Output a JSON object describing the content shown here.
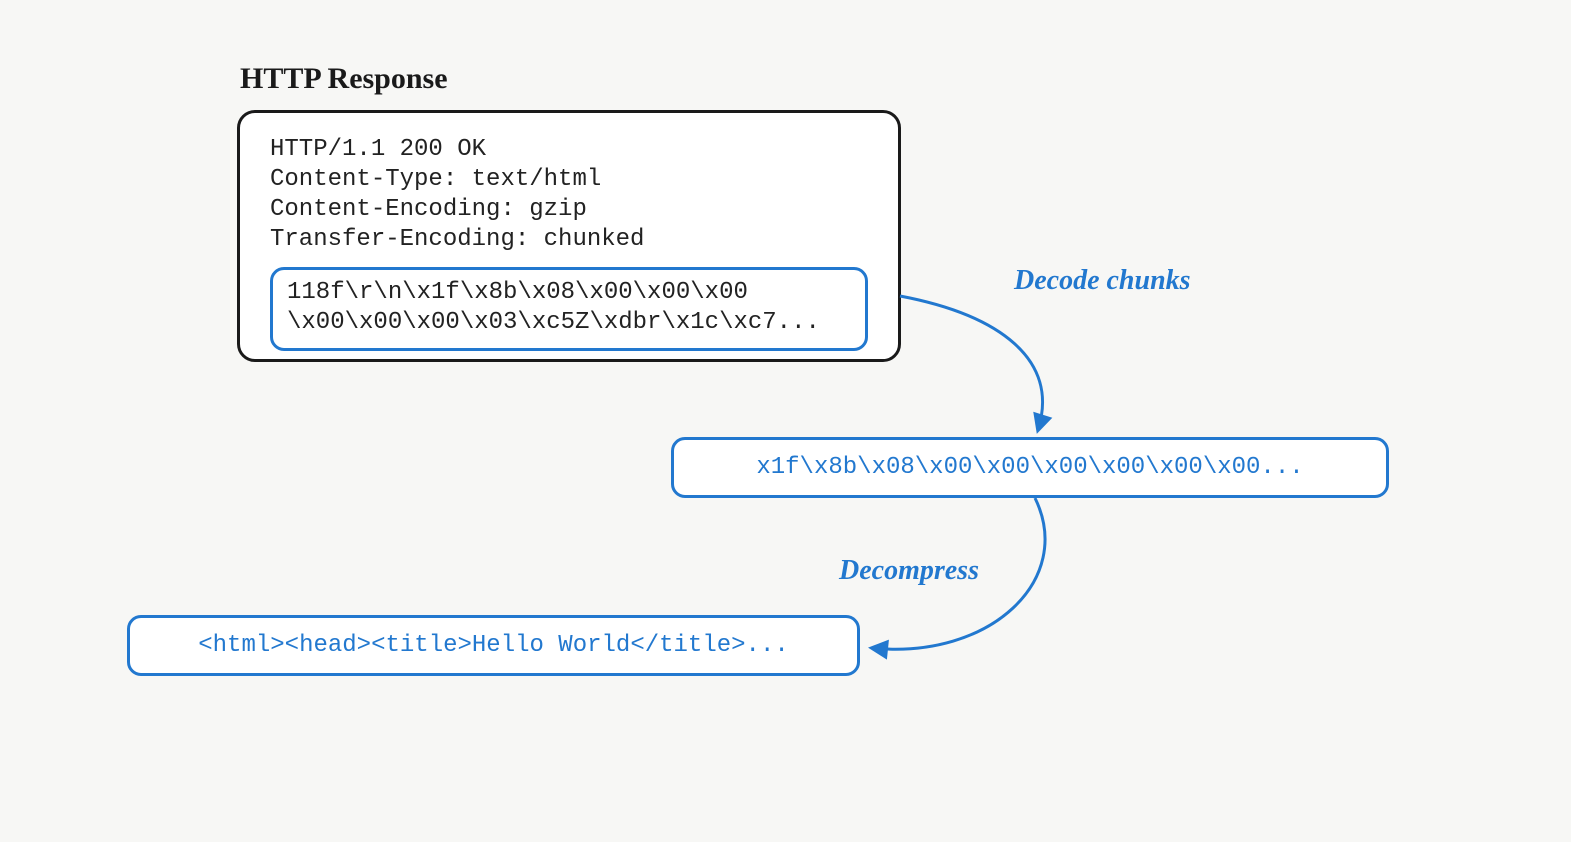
{
  "title": "HTTP Response",
  "response": {
    "headers_line1": "HTTP/1.1 200 OK",
    "headers_line2": "Content-Type: text/html",
    "headers_line3": "Content-Encoding: gzip",
    "headers_line4": "Transfer-Encoding: chunked",
    "body_line1": "118f\\r\\n\\x1f\\x8b\\x08\\x00\\x00\\x00",
    "body_line2": "\\x00\\x00\\x00\\x03\\xc5Z\\xdbr\\x1c\\xc7..."
  },
  "labels": {
    "decode_chunks": "Decode chunks",
    "decompress": "Decompress"
  },
  "decoded": "x1f\\x8b\\x08\\x00\\x00\\x00\\x00\\x00\\x00...",
  "final": "<html><head><title>Hello World</title>...",
  "colors": {
    "accent": "#2278cf",
    "ink": "#1a1a1a"
  }
}
